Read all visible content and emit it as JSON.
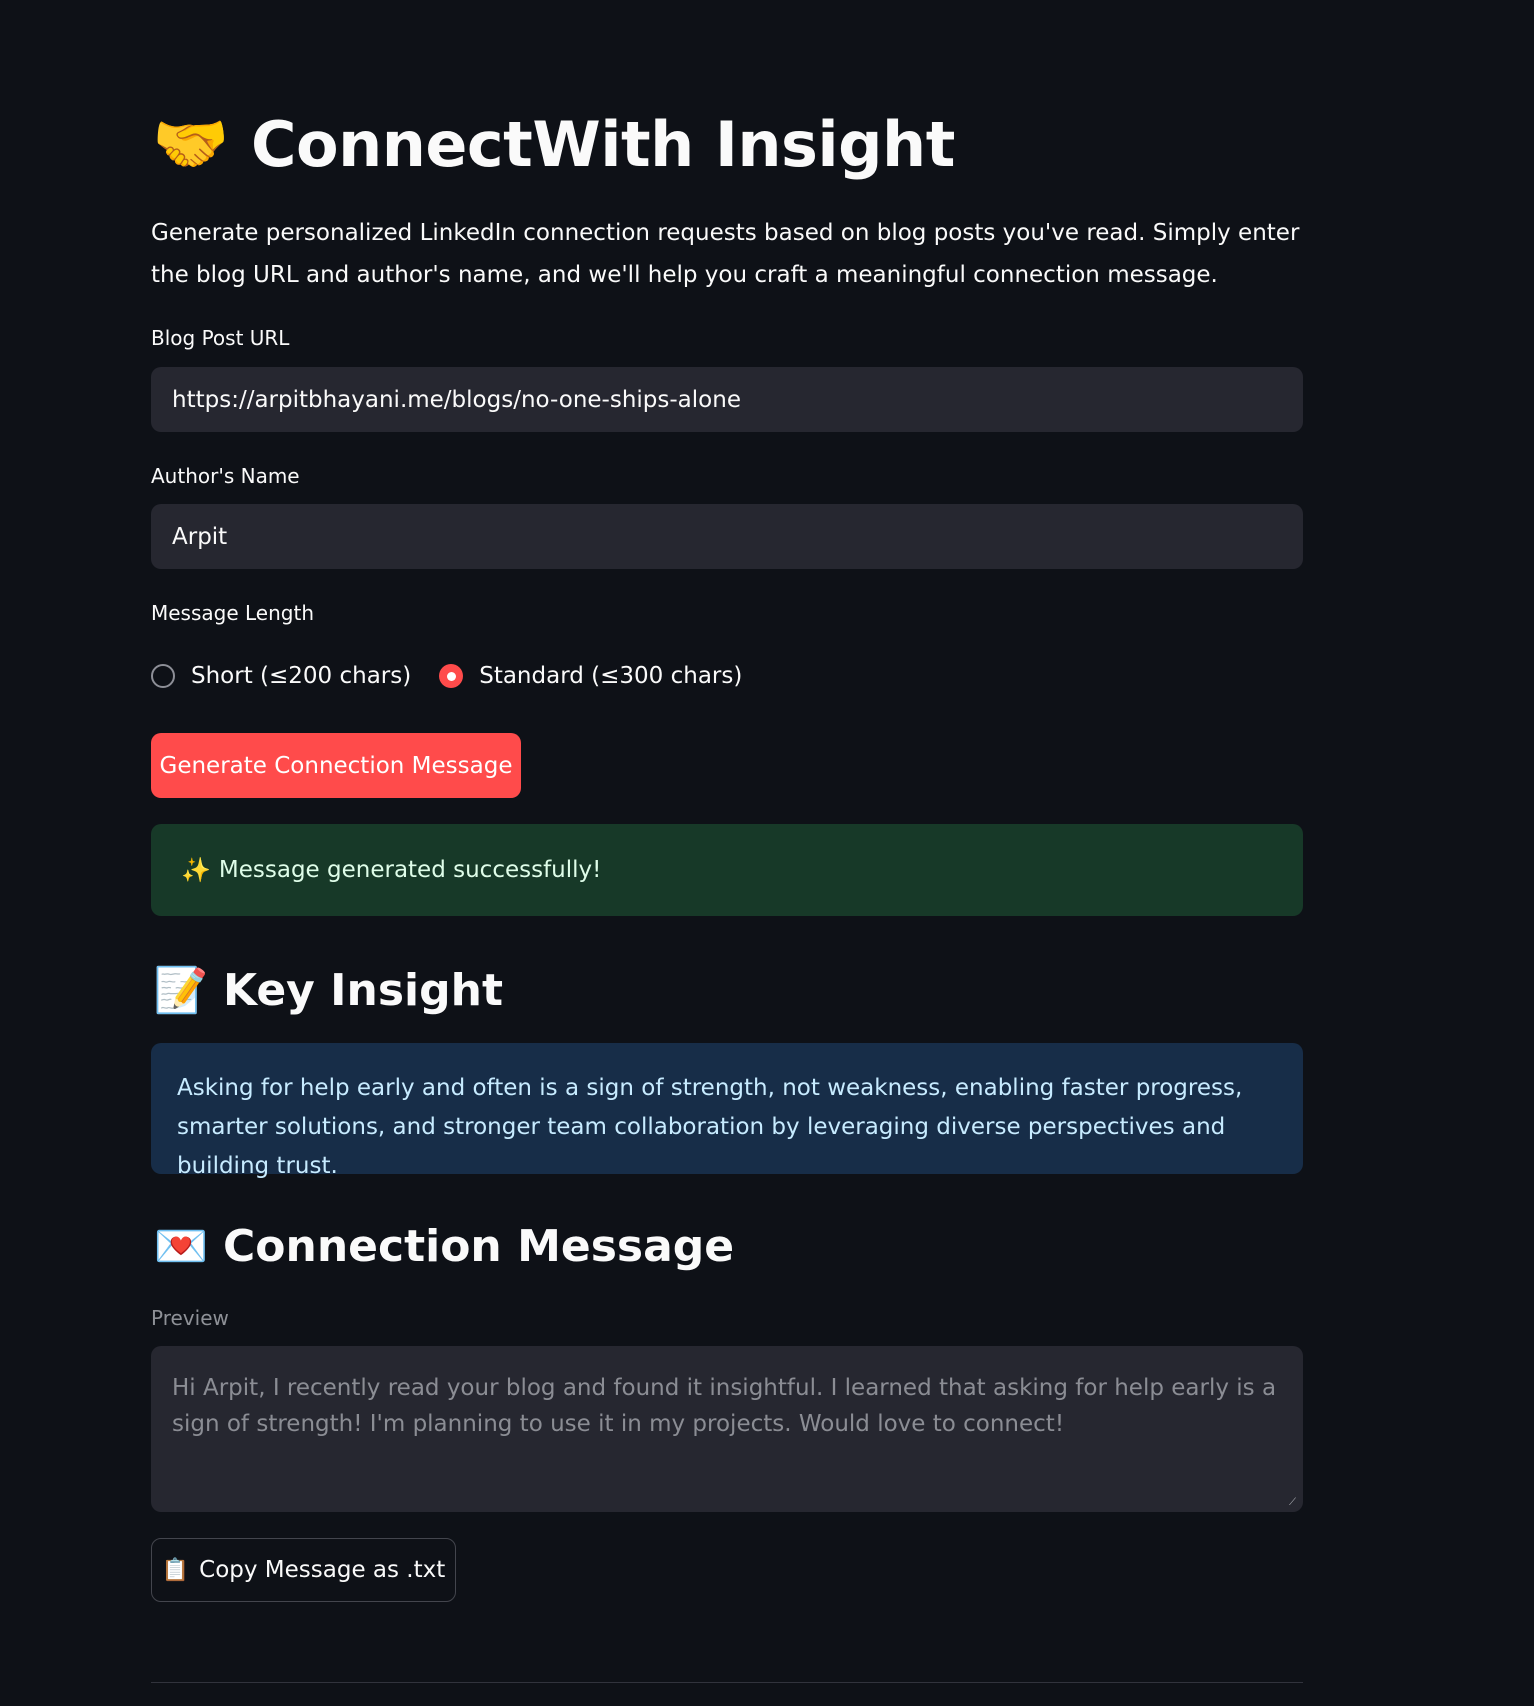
{
  "header": {
    "emoji": "🤝",
    "title": "ConnectWith Insight"
  },
  "description": "Generate personalized LinkedIn connection requests based on blog posts you've read. Simply enter the blog URL and author's name, and we'll help you craft a meaningful connection message.",
  "form": {
    "url_label": "Blog Post URL",
    "url_value": "https://arpitbhayani.me/blogs/no-one-ships-alone",
    "author_label": "Author's Name",
    "author_value": "Arpit",
    "length_label": "Message Length",
    "length_options": [
      {
        "label": "Short (≤200 chars)",
        "selected": false
      },
      {
        "label": "Standard (≤300 chars)",
        "selected": true
      }
    ],
    "generate_button": "Generate Connection Message"
  },
  "success": {
    "emoji": "✨",
    "text": "Message generated successfully!"
  },
  "key_insight": {
    "emoji": "📝",
    "heading": "Key Insight",
    "text": "Asking for help early and often is a sign of strength, not weakness, enabling faster progress, smarter solutions, and stronger team collaboration by leveraging diverse perspectives and building trust."
  },
  "connection_message": {
    "emoji": "💌",
    "heading": "Connection Message",
    "preview_label": "Preview",
    "preview_text": "Hi Arpit, I recently read your blog and found it insightful. I learned that asking for help early is a sign of strength! I'm planning to use it in my projects. Would love to connect!",
    "copy_emoji": "📋",
    "copy_button": "Copy Message as .txt"
  },
  "colors": {
    "background": "#0e1117",
    "primary": "#ff4b4b",
    "input_bg": "#262730",
    "success_bg": "#173928",
    "info_bg": "#172d48"
  }
}
